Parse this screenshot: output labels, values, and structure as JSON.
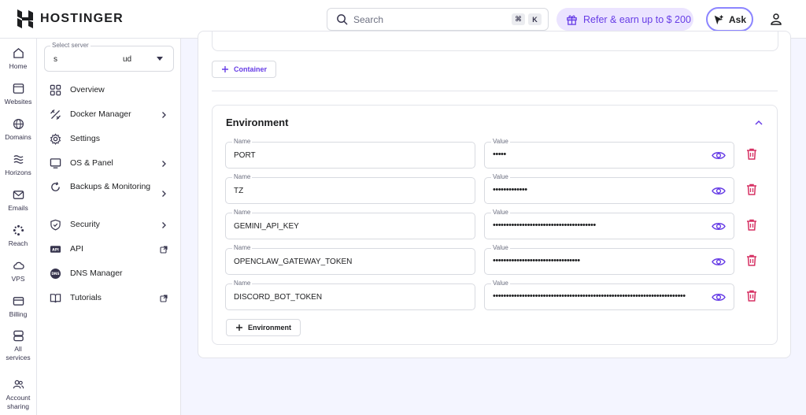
{
  "brand": {
    "name": "HOSTINGER"
  },
  "topbar": {
    "search_placeholder": "Search",
    "shortcut_keys": [
      "⌘",
      "K"
    ],
    "refer_label": "Refer & earn up to $ 200",
    "ask_label": "Ask"
  },
  "rail": {
    "items": [
      {
        "label": "Home",
        "icon": "home-icon"
      },
      {
        "label": "Websites",
        "icon": "websites-icon"
      },
      {
        "label": "Domains",
        "icon": "globe-icon"
      },
      {
        "label": "Horizons",
        "icon": "horizons-icon"
      },
      {
        "label": "Emails",
        "icon": "mail-icon"
      },
      {
        "label": "Reach",
        "icon": "reach-icon"
      },
      {
        "label": "VPS",
        "icon": "cloud-icon"
      },
      {
        "label": "Billing",
        "icon": "card-icon"
      },
      {
        "label": "All\nservices",
        "icon": "services-icon"
      },
      {
        "label": "Account\nsharing",
        "icon": "users-icon"
      }
    ]
  },
  "sidebar": {
    "server_label": "Select server",
    "server_value_start": "s",
    "server_value_end": "ud",
    "items": [
      {
        "label": "Overview",
        "icon": "grid-icon",
        "right": ""
      },
      {
        "label": "Docker Manager",
        "icon": "docker-icon",
        "right": "chevron"
      },
      {
        "label": "Settings",
        "icon": "gear-icon",
        "right": ""
      },
      {
        "label": "OS & Panel",
        "icon": "monitor-icon",
        "right": "chevron"
      },
      {
        "label": "Backups & Monitoring",
        "icon": "backup-icon",
        "right": "chevron"
      },
      {
        "label": "Security",
        "icon": "shield-icon",
        "right": "chevron"
      },
      {
        "label": "API",
        "icon": "api-icon",
        "right": "external"
      },
      {
        "label": "DNS Manager",
        "icon": "dns-icon",
        "right": ""
      },
      {
        "label": "Tutorials",
        "icon": "book-icon",
        "right": "external"
      }
    ]
  },
  "main": {
    "container_button": "Container",
    "environment": {
      "title": "Environment",
      "name_label": "Name",
      "value_label": "Value",
      "rows": [
        {
          "name": "PORT",
          "value": "•••••"
        },
        {
          "name": "TZ",
          "value": "•••••••••••••"
        },
        {
          "name": "GEMINI_API_KEY",
          "value": "•••••••••••••••••••••••••••••••••••••••"
        },
        {
          "name": "OPENCLAW_GATEWAY_TOKEN",
          "value": "•••••••••••••••••••••••••••••••••"
        },
        {
          "name": "DISCORD_BOT_TOKEN",
          "value": "•••••••••••••••••••••••••••••••••••••••••••••••••••••••••••••••••••••••••"
        }
      ],
      "add_button": "Environment"
    }
  },
  "colors": {
    "accent": "#673de6",
    "danger": "#d63163",
    "bg": "#f4f5ff"
  }
}
